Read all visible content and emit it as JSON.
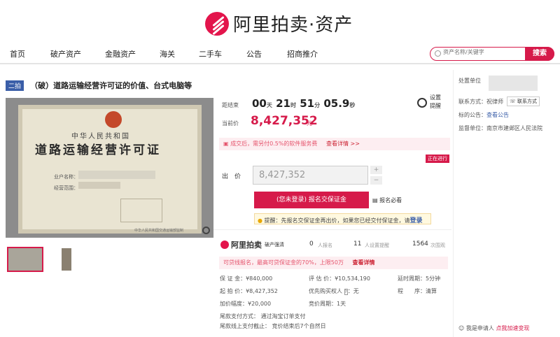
{
  "brand": {
    "name": "阿里拍卖·资产"
  },
  "nav": {
    "items": [
      "首页",
      "破产资产",
      "金融资产",
      "海关",
      "二手车",
      "公告",
      "招商推介"
    ]
  },
  "search": {
    "placeholder": "资产名称/关键字",
    "button": "搜索"
  },
  "auction": {
    "tag": "二拍",
    "title": "（破）道路运输经营许可证的价值、台式电脑等"
  },
  "certificate": {
    "line1": "中华人民共和国",
    "line2": "道路运输经营许可证",
    "field1": "业户名称：",
    "field2": "经营范围：",
    "foot": "中华人民共和国交通运输部监制"
  },
  "countdown": {
    "label": "距结束",
    "days": "00",
    "d_unit": "天",
    "hours": "21",
    "h_unit": "时",
    "minutes": "51",
    "m_unit": "分",
    "seconds": "05.9",
    "s_unit": "秒"
  },
  "remind_btn": {
    "line1": "设置",
    "line2": "提醒"
  },
  "price": {
    "label": "当前价",
    "value": "8,427,352",
    "unit": "元"
  },
  "fee_notice": {
    "text": "成交后，需另付0.5%的软件服务费",
    "link": "查看详情 >>"
  },
  "status": {
    "badge": "正在进行"
  },
  "bid": {
    "label": "出　价",
    "value": "8,427,352",
    "plus": "+",
    "minus": "−"
  },
  "actions": {
    "deposit": "(您未登录) 报名交保证金",
    "signup_required": "报名必看"
  },
  "reminder": {
    "text": "提醒：先报名交保证金再出价，如果您已经交付保证金，请",
    "link": "登录"
  },
  "stats": {
    "logo": "阿里拍卖",
    "logo_sub": "破产强清",
    "registered_count": "0",
    "registered_label": "人报名",
    "reminders_count": "11",
    "reminders_label": "人设置提醒",
    "views_count": "1564",
    "views_label": "次围观"
  },
  "loan_notice": {
    "text": "可贷线报名，最高可贷保证金的70%，上限50万",
    "link": "查看详情"
  },
  "details": [
    {
      "label": "保 证 金：",
      "value": "¥840,000"
    },
    {
      "label": "评 估 价：",
      "value": "¥10,534,190"
    },
    {
      "label": "延时周期：",
      "value": "5分钟"
    },
    {
      "label": "起 拍 价：",
      "value": "¥8,427,352"
    },
    {
      "label": "优先购买权人",
      "value": "无"
    },
    {
      "label": "程　　序：",
      "value": "清算"
    },
    {
      "label": "加价幅度：",
      "value": "¥20,000"
    },
    {
      "label": "竞价周期：",
      "value": "1天"
    },
    {
      "label": "尾款支付方式：",
      "value": "通过淘宝订单支付"
    },
    {
      "label": "尾款线上支付截止：",
      "value": "竞价结束后7个自然日"
    }
  ],
  "side": {
    "org_label": "处置单位",
    "contact_label": "联系方式：",
    "contact_name": "祝律师",
    "contact_btn": "联系方式",
    "notice_label": "标的公告：",
    "notice_link": "查看公告",
    "court_label": "监督单位：",
    "court_value": "南京市建邺区人民法院",
    "footer_text": "我是申请人",
    "footer_link": "点我加速变现"
  }
}
